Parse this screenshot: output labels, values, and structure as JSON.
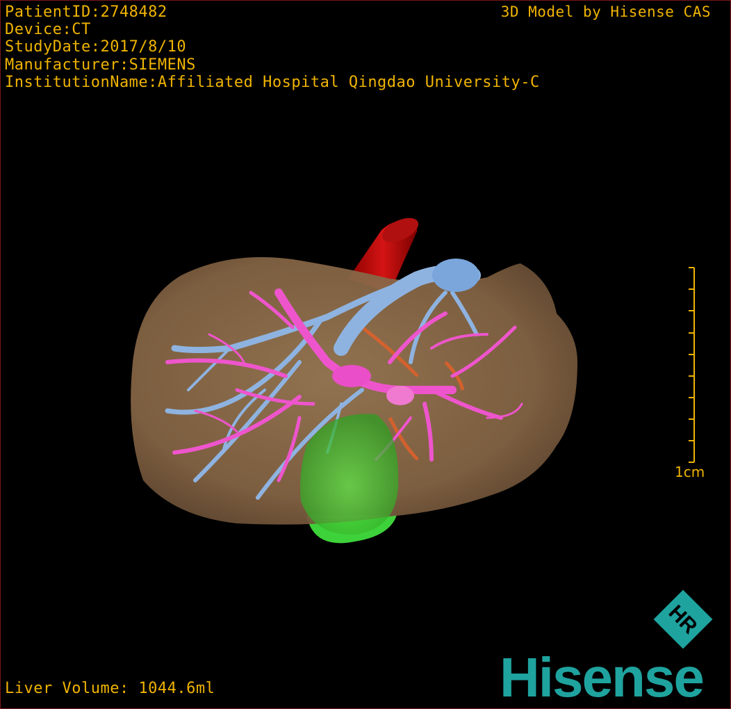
{
  "overlay": {
    "patient_id": "PatientID:2748482",
    "device": "Device:CT",
    "study_date": "StudyDate:2017/8/10",
    "manufacturer": "Manufacturer:SIEMENS",
    "institution": "InstitutionName:Affiliated Hospital Qingdao University-C",
    "brand_caption": "3D Model by Hisense CAS",
    "liver_volume": "Liver Volume: 1044.6ml"
  },
  "scale_bar": {
    "label": "1cm",
    "ticks": 10
  },
  "logo": {
    "name": "Hisense",
    "mark": "HR"
  },
  "colors": {
    "text": "#f0b400",
    "liver": "#8a6a45",
    "portal_vein": "#ee55cc",
    "hepatic_vein": "#8fb3e0",
    "aorta": "#c01010",
    "lesion": "#3fd23a",
    "logo": "#1fa39f",
    "border": "#7a1818"
  }
}
